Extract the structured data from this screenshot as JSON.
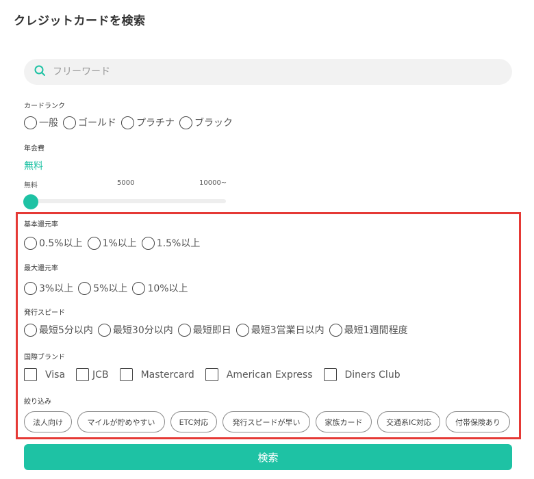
{
  "page": {
    "title": "クレジットカードを検索"
  },
  "search": {
    "placeholder": "フリーワード"
  },
  "card_rank": {
    "label": "カードランク",
    "options": [
      "一般",
      "ゴールド",
      "プラチナ",
      "ブラック"
    ]
  },
  "annual_fee": {
    "label": "年会費",
    "value": "無料",
    "slider_labels": [
      "無料",
      "5000",
      "10000~"
    ],
    "slider_value": 0
  },
  "basic_rate": {
    "label": "基本還元率",
    "options": [
      "0.5%以上",
      "1%以上",
      "1.5%以上"
    ]
  },
  "max_rate": {
    "label": "最大還元率",
    "options": [
      "3%以上",
      "5%以上",
      "10%以上"
    ]
  },
  "issue_speed": {
    "label": "発行スピード",
    "options": [
      "最短5分以内",
      "最短30分以内",
      "最短即日",
      "最短3営業日以内",
      "最短1週間程度"
    ]
  },
  "brand": {
    "label": "国際ブランド",
    "options": [
      "Visa",
      "JCB",
      "Mastercard",
      "American Express",
      "Diners Club"
    ]
  },
  "filter": {
    "label": "絞り込み",
    "chips": [
      "法人向け",
      "マイルが貯めやすい",
      "ETC対応",
      "発行スピードが早い",
      "家族カード",
      "交通系IC対応",
      "付帯保険あり"
    ]
  },
  "submit": {
    "label": "検索"
  },
  "colors": {
    "accent": "#1ec2a4",
    "highlight": "#e53935"
  }
}
